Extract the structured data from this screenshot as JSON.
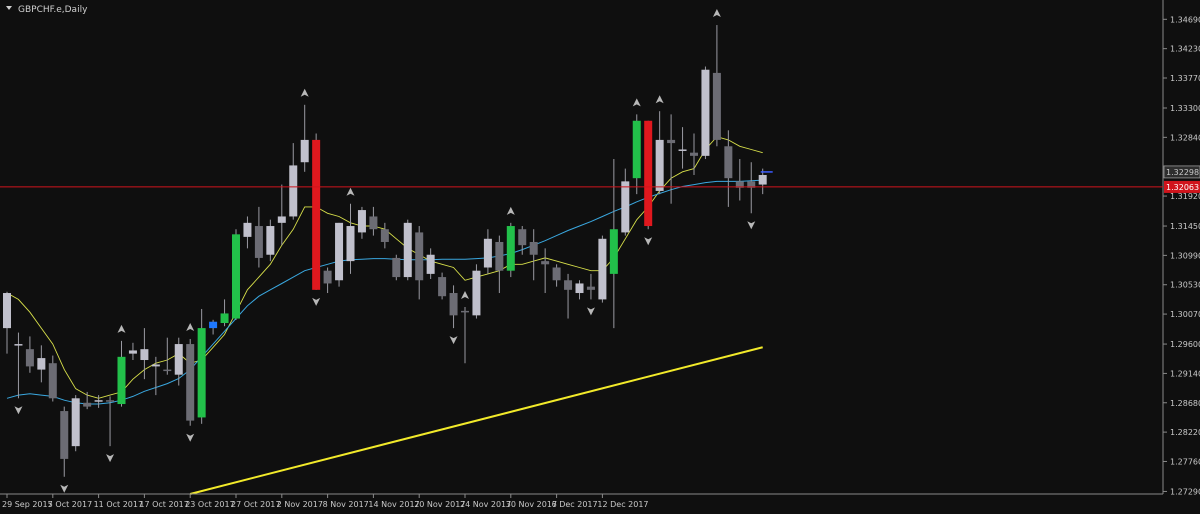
{
  "window": {
    "symbol_title": "GBPCHF.e,Daily"
  },
  "colors": {
    "background": "#0f0f0f",
    "grid": "#2a2a2a",
    "axis_text": "#c9c9c9",
    "bull_green": "#22c04a",
    "bear_red": "#e0181e",
    "bull_gray": "#c0c0cc",
    "bear_gray": "#6c6c74",
    "signal_blue": "#1e78ff",
    "ma_fast": "#d8e04a",
    "ma_mid": "#3aa8e0",
    "ma_slow": "#f2ea2a",
    "price_line": "#d0141c"
  },
  "chart_data": {
    "type": "candlestick",
    "title": "GBPCHF.e,Daily",
    "xlabel": "",
    "ylabel": "",
    "ylim": [
      1.2725,
      1.3493
    ],
    "y_ticks": [
      "1.34690",
      "1.34230",
      "1.33770",
      "1.33300",
      "1.32840",
      "1.31920",
      "1.31450",
      "1.30990",
      "1.30530",
      "1.30070",
      "1.29600",
      "1.29140",
      "1.28680",
      "1.28220",
      "1.27760",
      "1.27290"
    ],
    "x_tick_labels": [
      {
        "label": "29 Sep 2017",
        "index": 0
      },
      {
        "label": "5 Oct 2017",
        "index": 4
      },
      {
        "label": "11 Oct 2017",
        "index": 8
      },
      {
        "label": "17 Oct 2017",
        "index": 12
      },
      {
        "label": "23 Oct 2017",
        "index": 16
      },
      {
        "label": "27 Oct 2017",
        "index": 20
      },
      {
        "label": "2 Nov 2017",
        "index": 24
      },
      {
        "label": "8 Nov 2017",
        "index": 28
      },
      {
        "label": "14 Nov 2017",
        "index": 32
      },
      {
        "label": "20 Nov 2017",
        "index": 36
      },
      {
        "label": "24 Nov 2017",
        "index": 40
      },
      {
        "label": "30 Nov 2017",
        "index": 44
      },
      {
        "label": "6 Dec 2017",
        "index": 48
      },
      {
        "label": "12 Dec 2017",
        "index": 52
      }
    ],
    "candles": [
      {
        "o": 1.2985,
        "h": 1.3042,
        "l": 1.2945,
        "c": 1.304,
        "k": "bg"
      },
      {
        "o": 1.2958,
        "h": 1.2978,
        "l": 1.2875,
        "c": 1.296,
        "k": "bg"
      },
      {
        "o": 1.2952,
        "h": 1.2972,
        "l": 1.2915,
        "c": 1.2925,
        "k": "dg"
      },
      {
        "o": 1.2938,
        "h": 1.2958,
        "l": 1.29,
        "c": 1.292,
        "k": "bg"
      },
      {
        "o": 1.293,
        "h": 1.2942,
        "l": 1.287,
        "c": 1.2875,
        "k": "dg"
      },
      {
        "o": 1.2855,
        "h": 1.2862,
        "l": 1.2752,
        "c": 1.278,
        "k": "dg"
      },
      {
        "o": 1.28,
        "h": 1.288,
        "l": 1.2792,
        "c": 1.2875,
        "k": "bg"
      },
      {
        "o": 1.2868,
        "h": 1.2885,
        "l": 1.2858,
        "c": 1.2862,
        "k": "dg"
      },
      {
        "o": 1.287,
        "h": 1.288,
        "l": 1.286,
        "c": 1.2872,
        "k": "bg"
      },
      {
        "o": 1.287,
        "h": 1.2878,
        "l": 1.28,
        "c": 1.2872,
        "k": "dg"
      },
      {
        "o": 1.2866,
        "h": 1.2965,
        "l": 1.2862,
        "c": 1.294,
        "k": "gr"
      },
      {
        "o": 1.2945,
        "h": 1.2962,
        "l": 1.2935,
        "c": 1.295,
        "k": "bg"
      },
      {
        "o": 1.2952,
        "h": 1.2985,
        "l": 1.2905,
        "c": 1.2935,
        "k": "bg"
      },
      {
        "o": 1.2928,
        "h": 1.294,
        "l": 1.288,
        "c": 1.2925,
        "k": "bg"
      },
      {
        "o": 1.292,
        "h": 1.297,
        "l": 1.2912,
        "c": 1.2918,
        "k": "dg"
      },
      {
        "o": 1.296,
        "h": 1.297,
        "l": 1.2895,
        "c": 1.2912,
        "k": "bg"
      },
      {
        "o": 1.296,
        "h": 1.2968,
        "l": 1.2832,
        "c": 1.284,
        "k": "dg"
      },
      {
        "o": 1.2845,
        "h": 1.3015,
        "l": 1.2835,
        "c": 1.2985,
        "k": "gr"
      },
      {
        "o": 1.2985,
        "h": 1.2998,
        "l": 1.2975,
        "c": 1.2995,
        "k": "bl"
      },
      {
        "o": 1.2993,
        "h": 1.303,
        "l": 1.2988,
        "c": 1.3008,
        "k": "gr"
      },
      {
        "o": 1.3,
        "h": 1.314,
        "l": 1.2998,
        "c": 1.3132,
        "k": "gr"
      },
      {
        "o": 1.3128,
        "h": 1.316,
        "l": 1.311,
        "c": 1.315,
        "k": "bg"
      },
      {
        "o": 1.3145,
        "h": 1.3175,
        "l": 1.308,
        "c": 1.3095,
        "k": "dg"
      },
      {
        "o": 1.31,
        "h": 1.3155,
        "l": 1.309,
        "c": 1.3145,
        "k": "bg"
      },
      {
        "o": 1.315,
        "h": 1.321,
        "l": 1.3115,
        "c": 1.316,
        "k": "bg"
      },
      {
        "o": 1.316,
        "h": 1.3275,
        "l": 1.3155,
        "c": 1.324,
        "k": "bg"
      },
      {
        "o": 1.3245,
        "h": 1.3335,
        "l": 1.323,
        "c": 1.328,
        "k": "bg"
      },
      {
        "o": 1.328,
        "h": 1.329,
        "l": 1.3045,
        "c": 1.3045,
        "k": "rd"
      },
      {
        "o": 1.3055,
        "h": 1.308,
        "l": 1.304,
        "c": 1.3075,
        "k": "dg"
      },
      {
        "o": 1.306,
        "h": 1.315,
        "l": 1.305,
        "c": 1.315,
        "k": "bg"
      },
      {
        "o": 1.3145,
        "h": 1.318,
        "l": 1.307,
        "c": 1.309,
        "k": "bg"
      },
      {
        "o": 1.3135,
        "h": 1.3175,
        "l": 1.3125,
        "c": 1.317,
        "k": "bg"
      },
      {
        "o": 1.316,
        "h": 1.3175,
        "l": 1.313,
        "c": 1.314,
        "k": "dg"
      },
      {
        "o": 1.314,
        "h": 1.315,
        "l": 1.311,
        "c": 1.312,
        "k": "dg"
      },
      {
        "o": 1.3095,
        "h": 1.31,
        "l": 1.306,
        "c": 1.3065,
        "k": "dg"
      },
      {
        "o": 1.3065,
        "h": 1.3155,
        "l": 1.306,
        "c": 1.315,
        "k": "bg"
      },
      {
        "o": 1.3135,
        "h": 1.3145,
        "l": 1.303,
        "c": 1.306,
        "k": "dg"
      },
      {
        "o": 1.307,
        "h": 1.311,
        "l": 1.3062,
        "c": 1.31,
        "k": "bg"
      },
      {
        "o": 1.3065,
        "h": 1.3072,
        "l": 1.303,
        "c": 1.3035,
        "k": "dg"
      },
      {
        "o": 1.304,
        "h": 1.3052,
        "l": 1.2985,
        "c": 1.3005,
        "k": "dg"
      },
      {
        "o": 1.301,
        "h": 1.3018,
        "l": 1.293,
        "c": 1.3012,
        "k": "dg"
      },
      {
        "o": 1.3005,
        "h": 1.3085,
        "l": 1.3,
        "c": 1.3075,
        "k": "bg"
      },
      {
        "o": 1.308,
        "h": 1.314,
        "l": 1.307,
        "c": 1.3125,
        "k": "bg"
      },
      {
        "o": 1.312,
        "h": 1.313,
        "l": 1.304,
        "c": 1.3075,
        "k": "dg"
      },
      {
        "o": 1.3075,
        "h": 1.315,
        "l": 1.3065,
        "c": 1.3145,
        "k": "gr"
      },
      {
        "o": 1.314,
        "h": 1.3145,
        "l": 1.31,
        "c": 1.3115,
        "k": "dg"
      },
      {
        "o": 1.312,
        "h": 1.314,
        "l": 1.306,
        "c": 1.31,
        "k": "dg"
      },
      {
        "o": 1.309,
        "h": 1.311,
        "l": 1.304,
        "c": 1.3085,
        "k": "dg"
      },
      {
        "o": 1.308,
        "h": 1.3085,
        "l": 1.305,
        "c": 1.306,
        "k": "dg"
      },
      {
        "o": 1.306,
        "h": 1.307,
        "l": 1.3,
        "c": 1.3045,
        "k": "dg"
      },
      {
        "o": 1.304,
        "h": 1.306,
        "l": 1.303,
        "c": 1.3055,
        "k": "bg"
      },
      {
        "o": 1.305,
        "h": 1.307,
        "l": 1.303,
        "c": 1.3045,
        "k": "dg"
      },
      {
        "o": 1.303,
        "h": 1.313,
        "l": 1.3025,
        "c": 1.3125,
        "k": "bg"
      },
      {
        "o": 1.307,
        "h": 1.325,
        "l": 1.2985,
        "c": 1.314,
        "k": "gr"
      },
      {
        "o": 1.3135,
        "h": 1.3235,
        "l": 1.313,
        "c": 1.3215,
        "k": "bg"
      },
      {
        "o": 1.322,
        "h": 1.332,
        "l": 1.3195,
        "c": 1.331,
        "k": "gr"
      },
      {
        "o": 1.331,
        "h": 1.331,
        "l": 1.314,
        "c": 1.3145,
        "k": "rd"
      },
      {
        "o": 1.32,
        "h": 1.3325,
        "l": 1.3195,
        "c": 1.328,
        "k": "bg"
      },
      {
        "o": 1.328,
        "h": 1.332,
        "l": 1.318,
        "c": 1.3275,
        "k": "dg"
      },
      {
        "o": 1.3265,
        "h": 1.33,
        "l": 1.3235,
        "c": 1.3265,
        "k": "bg"
      },
      {
        "o": 1.326,
        "h": 1.329,
        "l": 1.3225,
        "c": 1.3255,
        "k": "dg"
      },
      {
        "o": 1.3255,
        "h": 1.3395,
        "l": 1.325,
        "c": 1.339,
        "k": "bg"
      },
      {
        "o": 1.3385,
        "h": 1.346,
        "l": 1.327,
        "c": 1.328,
        "k": "dg"
      },
      {
        "o": 1.327,
        "h": 1.3295,
        "l": 1.3175,
        "c": 1.322,
        "k": "dg"
      },
      {
        "o": 1.3215,
        "h": 1.325,
        "l": 1.3185,
        "c": 1.3205,
        "k": "dg"
      },
      {
        "o": 1.3205,
        "h": 1.3245,
        "l": 1.3165,
        "c": 1.3215,
        "k": "dg"
      },
      {
        "o": 1.321,
        "h": 1.3235,
        "l": 1.3195,
        "c": 1.3225,
        "k": "bg"
      }
    ],
    "ma_fast": [
      1.304,
      1.303,
      1.301,
      1.2985,
      1.296,
      1.292,
      1.289,
      1.288,
      1.2875,
      1.288,
      1.2885,
      1.2905,
      1.292,
      1.293,
      1.2935,
      1.2945,
      1.293,
      1.2935,
      1.2955,
      1.2975,
      1.301,
      1.3045,
      1.3065,
      1.3085,
      1.3115,
      1.314,
      1.3175,
      1.3175,
      1.3165,
      1.316,
      1.315,
      1.3145,
      1.3145,
      1.314,
      1.3125,
      1.311,
      1.31,
      1.309,
      1.3085,
      1.308,
      1.306,
      1.3065,
      1.307,
      1.3075,
      1.3085,
      1.3085,
      1.309,
      1.3095,
      1.309,
      1.3085,
      1.308,
      1.3075,
      1.3075,
      1.3095,
      1.3125,
      1.3155,
      1.3175,
      1.32,
      1.322,
      1.323,
      1.3235,
      1.3265,
      1.3285,
      1.328,
      1.327,
      1.3265,
      1.326
    ],
    "ma_mid": [
      1.2875,
      1.288,
      1.2882,
      1.288,
      1.2878,
      1.2872,
      1.2868,
      1.2866,
      1.2866,
      1.2868,
      1.2872,
      1.2878,
      1.2886,
      1.2892,
      1.2898,
      1.2906,
      1.292,
      1.294,
      1.296,
      1.298,
      1.3,
      1.302,
      1.3035,
      1.3045,
      1.3055,
      1.3065,
      1.3075,
      1.308,
      1.3085,
      1.309,
      1.3092,
      1.3093,
      1.3094,
      1.3094,
      1.3093,
      1.3092,
      1.3092,
      1.3092,
      1.3093,
      1.3093,
      1.3093,
      1.3094,
      1.3095,
      1.3098,
      1.3102,
      1.3108,
      1.3115,
      1.3122,
      1.313,
      1.3138,
      1.3145,
      1.3152,
      1.316,
      1.3168,
      1.3175,
      1.3183,
      1.319,
      1.3196,
      1.3202,
      1.3207,
      1.321,
      1.3213,
      1.3215,
      1.3215,
      1.3215,
      1.3216,
      1.3217
    ],
    "ma_slow": {
      "start_index": 16,
      "start_value": 1.2725,
      "end_index": 66,
      "end_value": 1.2955
    },
    "current_price": "1.32298",
    "price_line_label": "1.32063",
    "price_line_value": 1.32063,
    "arrows_up": [
      10,
      16,
      26,
      30,
      40,
      44,
      55,
      57,
      62
    ],
    "arrows_down": [
      1,
      5,
      9,
      16,
      27,
      39,
      51,
      56,
      65
    ]
  }
}
